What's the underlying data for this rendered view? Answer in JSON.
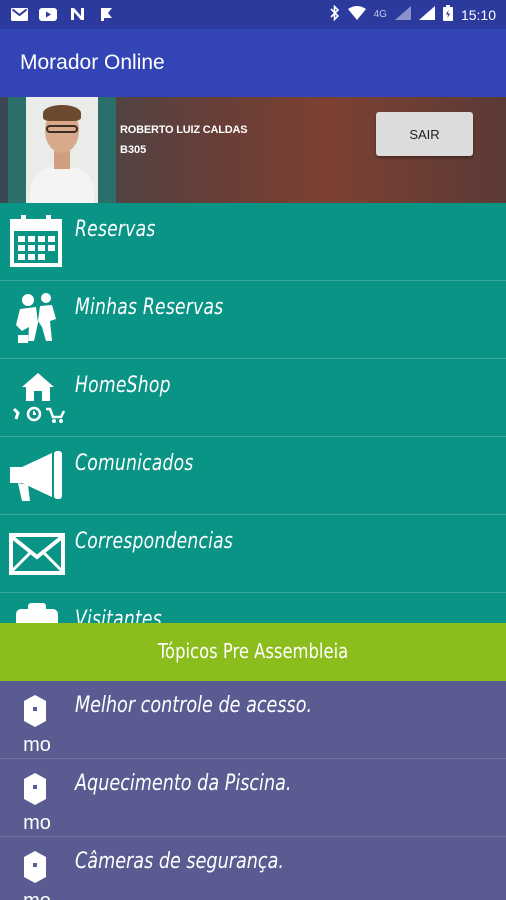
{
  "status_bar": {
    "left_icons": [
      "gmail-icon",
      "youtube-icon",
      "n-icon",
      "flag-icon"
    ],
    "network": "4G",
    "time": "15:10"
  },
  "app_bar": {
    "title": "Morador Online"
  },
  "profile": {
    "name": "ROBERTO LUIZ CALDAS",
    "unit": "B305",
    "logout_label": "SAIR"
  },
  "menu": [
    {
      "label": "Reservas",
      "icon": "calendar-icon"
    },
    {
      "label": "Minhas Reservas",
      "icon": "people-icon"
    },
    {
      "label": "HomeShop",
      "icon": "home-shop-icon"
    },
    {
      "label": "Comunicados",
      "icon": "megaphone-icon"
    },
    {
      "label": "Correspondencias",
      "icon": "envelope-icon"
    },
    {
      "label": "Visitantes",
      "icon": "visitor-icon"
    }
  ],
  "banner": {
    "title": "Tópicos Pre Assembleia"
  },
  "topics": [
    {
      "label": "Melhor controle de acesso.",
      "icon_text": "mo"
    },
    {
      "label": "Aquecimento da Piscina.",
      "icon_text": "mo"
    },
    {
      "label": "Câmeras de segurança.",
      "icon_text": "mo"
    }
  ]
}
